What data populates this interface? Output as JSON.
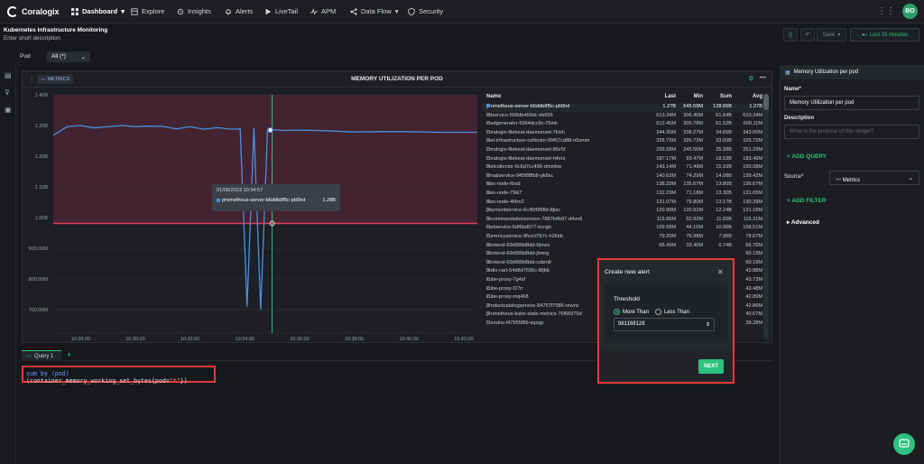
{
  "nav": {
    "brand": "Coralogix",
    "items": [
      "Dashboard",
      "Explore",
      "Insights",
      "Alerts",
      "LiveTail",
      "APM",
      "Data Flow",
      "Security"
    ],
    "avatar": "BO"
  },
  "dashboard": {
    "title": "Kubernetes Infrastructure Monitoring",
    "description": "Enter short description",
    "save_label": "Save",
    "time_range": "Last 15 minutes"
  },
  "filter": {
    "label": "Pod",
    "value": "All (*)"
  },
  "widget": {
    "tag": "METRICS",
    "title": "MEMORY UTILIZATION PER POD",
    "threshold_color": "#e0405a",
    "series_color": "#4a90e2",
    "cursor_color": "#2ec27e"
  },
  "chart_data": {
    "type": "line",
    "title": "MEMORY UTILIZATION PER POD",
    "y_ticks": [
      "1.40B",
      "1.30B",
      "1.20B",
      "1.10B",
      "1.00B",
      "900.00M",
      "800.00M",
      "700.00M"
    ],
    "x_ticks": [
      "10:28:00",
      "10:30:00",
      "10:32:00",
      "10:34:00",
      "10:36:00",
      "10:38:00",
      "10:40:00",
      "10:42:00"
    ],
    "threshold": 0.98116,
    "highlight_band": [
      0.98116,
      1.4
    ],
    "ylim": [
      0.665,
      1.4
    ],
    "series": [
      {
        "name": "prometheus-server-b6ddb8f5c-pb5hd",
        "x": [
          "10:27:00",
          "10:27:30",
          "10:28:00",
          "10:28:30",
          "10:29:00",
          "10:29:30",
          "10:30:00",
          "10:30:30",
          "10:31:00",
          "10:31:30",
          "10:32:00",
          "10:32:30",
          "10:33:00",
          "10:33:30",
          "10:33:50",
          "10:34:05",
          "10:34:20",
          "10:34:35",
          "10:34:50",
          "10:35:20",
          "10:36:00",
          "10:37:00",
          "10:38:00",
          "10:39:00",
          "10:40:00",
          "10:41:00",
          "10:42:00",
          "10:42:30"
        ],
        "y": [
          1.268,
          1.296,
          1.3,
          1.292,
          1.296,
          1.3,
          1.296,
          1.298,
          1.297,
          1.289,
          1.296,
          1.288,
          1.293,
          1.288,
          1.289,
          0.71,
          1.292,
          0.7,
          1.288,
          1.284,
          1.285,
          1.283,
          1.279,
          1.28,
          1.28,
          1.278,
          1.278,
          1.278
        ]
      }
    ],
    "cursor_x": "10:35:00"
  },
  "tooltip": {
    "time": "01/08/2023 10:34:57",
    "series": "prometheus-server-b6ddb8f5c-pb5hd",
    "value": "1.28B"
  },
  "legend": {
    "headers": [
      "Name",
      "Last",
      "Min",
      "Sum",
      "Avg"
    ],
    "rows": [
      [
        "prometheus-server-b6ddb8f5c-pb5hd",
        "1.27B",
        "645.59M",
        "128.65B",
        "1.27B"
      ],
      [
        "adservice-558db469dc-kb656",
        "613.34M",
        "306.45M",
        "61.64B",
        "610.34M"
      ],
      [
        "loadgenerator-5964dcc9c-76mk",
        "612.45M",
        "306.78M",
        "61.52B",
        "609.11M"
      ],
      [
        "coralogix-filebeat-daemonset-7kish",
        "344.30M",
        "338.27M",
        "34.65B",
        "343.00M"
      ],
      [
        "otel-infrastructure-collector-6f457cd88-n5smm",
        "326.72M",
        "326.72M",
        "33.00B",
        "326.72M"
      ],
      [
        "coralogix-filebeat-daemonset-89z5f",
        "256.58M",
        "245.56M",
        "25.38B",
        "251.29M"
      ],
      [
        "coralogix-filebeat-daemonset-h4xrs",
        "187.17M",
        "93.47M",
        "18.53B",
        "183.46M"
      ],
      [
        "otelcollector-6c6d7cc496-dmmbw",
        "143.14M",
        "71.49M",
        "15.16B",
        "150.08M"
      ],
      [
        "emailservice-945f88fb8-pk8sc",
        "140.62M",
        "74.29M",
        "14.08B",
        "139.42M"
      ],
      [
        "aws-node-lfzsd",
        "138.32M",
        "135.67M",
        "13.80B",
        "136.67M"
      ],
      [
        "aws-node-79kl7",
        "132.23M",
        "71.18M",
        "13.30B",
        "131.65M"
      ],
      [
        "aws-node-4f4m2",
        "131.07M",
        "79.80M",
        "13.17B",
        "130.39M"
      ],
      [
        "paymentservice-6c45f6f98d-8jtsc",
        "120.99M",
        "120.91M",
        "12.24B",
        "121.16M"
      ],
      [
        "recommendationservice-7887b4b97-d4vn6",
        "115.85M",
        "52.92M",
        "11.65B",
        "115.31M"
      ],
      [
        "cartservice-5df6bd977-kcngn",
        "109.58M",
        "44.15M",
        "10.96B",
        "108.51M"
      ],
      [
        "currencyservice-9fcccf7b7c-h2kbb",
        "79.20M",
        "76.98M",
        "7.95B",
        "78.67M"
      ],
      [
        "frontend-69d989d8dd-6bnzs",
        "66.49M",
        "33.46M",
        "6.74B",
        "66.76M"
      ],
      [
        "frontend-69d989d8dd-jbmrg",
        "",
        "",
        "",
        "60.19M"
      ],
      [
        "frontend-69d989d8dd-cxbm8",
        "",
        "",
        "",
        "60.19M"
      ],
      [
        "redis-cart-54d8d7695c-8fjbb",
        "",
        "",
        "",
        "43.88M"
      ],
      [
        "kube-proxy-7g4zf",
        "",
        "",
        "",
        "43.73M"
      ],
      [
        "kube-proxy-f27rr",
        "",
        "",
        "",
        "43.48M"
      ],
      [
        "kube-proxy-mq468",
        "",
        "",
        "",
        "42.89M"
      ],
      [
        "productcatalogservice-84757f7586-orwnc",
        "",
        "",
        "",
        "42.86M"
      ],
      [
        "prometheus-kube-state-metrics-76f66976d",
        "",
        "",
        "",
        "40.67M"
      ],
      [
        "coredns-f47955f89-sqzqp",
        "",
        "",
        "",
        "39.28M"
      ]
    ]
  },
  "query": {
    "tab_label": "Query 1",
    "add": "+",
    "kw1": "sum by",
    "group": "(pod)",
    "metric": "(container_memory_working_set_bytes{pod=",
    "str": "\"*\"",
    "close": "})"
  },
  "right_panel": {
    "header": "Memory Utilization per pod",
    "name_label": "Name*",
    "name_value": "Memory Utilization per pod",
    "description_label": "Description",
    "description_placeholder": "What is the purpose of this widget?",
    "add_query": "ADD QUERY",
    "source_label": "Source*",
    "source_value": "Metrics",
    "add_filter": "ADD FILTER",
    "advanced": "Advanced"
  },
  "alert": {
    "title": "Create new alert",
    "threshold_label": "Threshold",
    "option_more": "More Than",
    "option_less": "Less Than",
    "selected": "More Than",
    "value": "981168128",
    "next": "NEXT"
  }
}
